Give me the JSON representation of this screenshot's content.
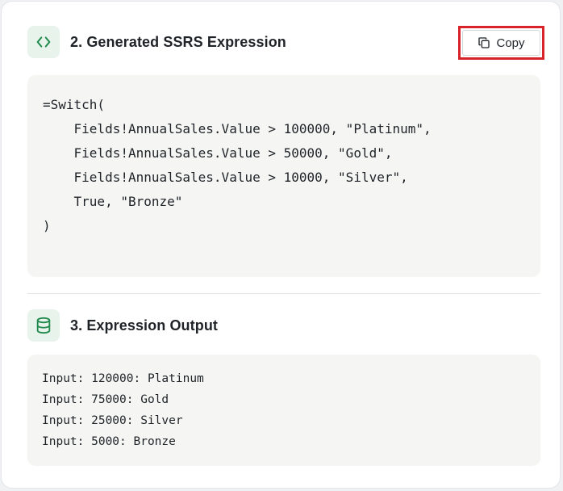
{
  "expression_section": {
    "title": "2. Generated SSRS Expression",
    "icon": "code-brackets-icon",
    "copy_button": {
      "label": "Copy",
      "icon": "copy-icon"
    },
    "code_lines": [
      "=Switch(",
      "    Fields!AnnualSales.Value > 100000, \"Platinum\",",
      "    Fields!AnnualSales.Value > 50000, \"Gold\",",
      "    Fields!AnnualSales.Value > 10000, \"Silver\",",
      "    True, \"Bronze\"",
      ")"
    ]
  },
  "output_section": {
    "title": "3. Expression Output",
    "icon": "database-icon",
    "output_lines": [
      "Input: 120000: Platinum",
      "Input: 75000: Gold",
      "Input: 25000: Silver",
      "Input: 5000: Bronze"
    ]
  },
  "colors": {
    "accent_green": "#1f8a4c",
    "icon_badge_bg": "#e8f3ec",
    "highlight_red": "#d9232a",
    "code_bg": "#f5f6f4"
  }
}
